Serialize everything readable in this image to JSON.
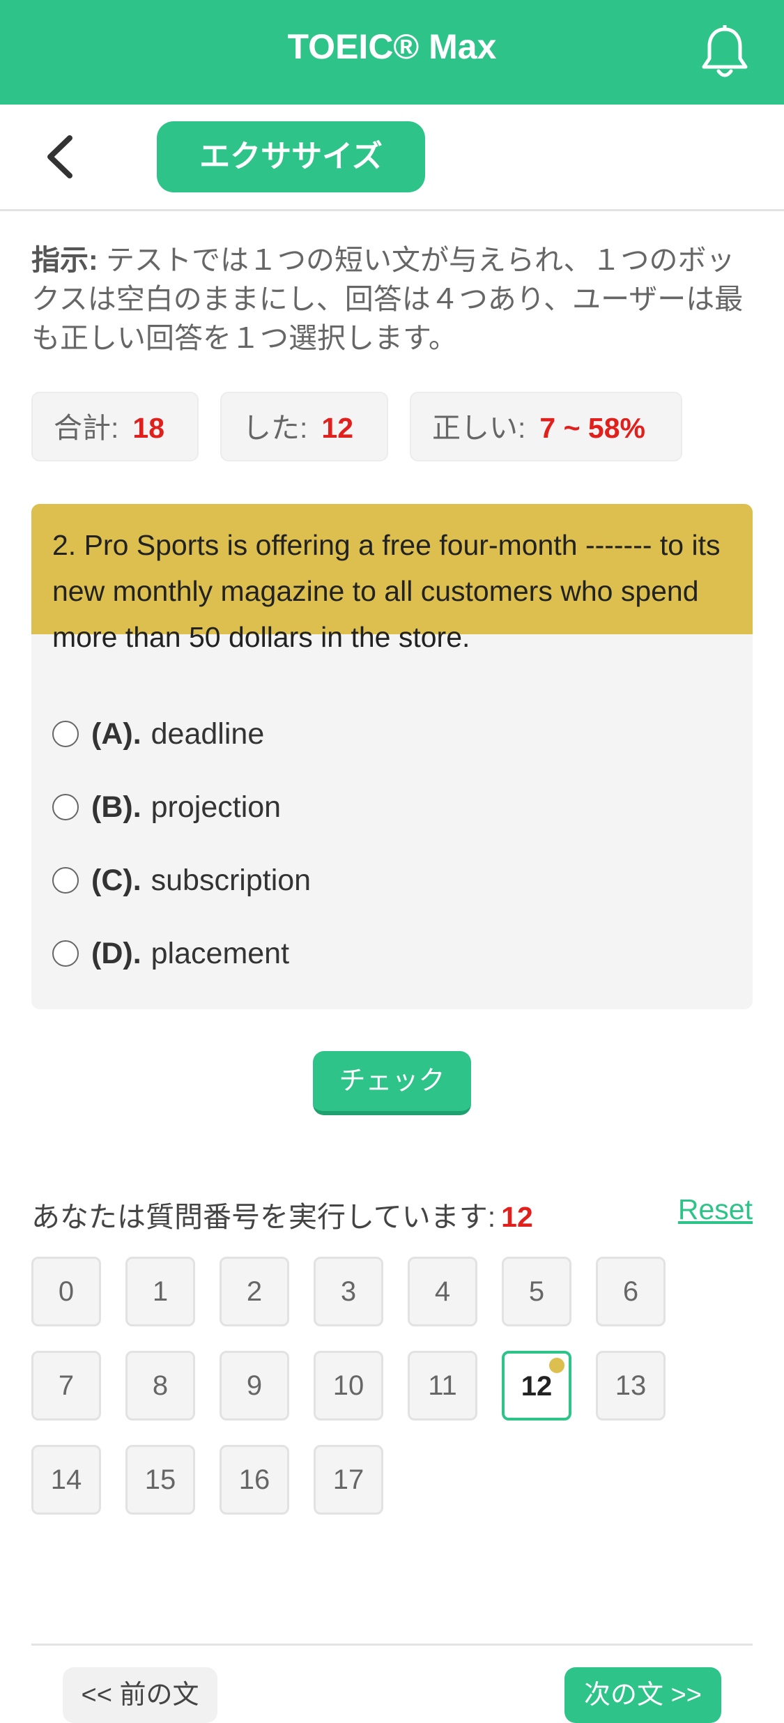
{
  "app": {
    "title": "TOEIC® Max"
  },
  "nav": {
    "tab_label": "エクササイズ"
  },
  "instructions": {
    "label": "指示:",
    "text": " テストでは１つの短い文が与えられ、１つのボックスは空白のままにし、回答は４つあり、ユーザーは最も正しい回答を１つ選択します。"
  },
  "stats": {
    "total_label": "合計:",
    "total_value": "18",
    "done_label": "した:",
    "done_value": "12",
    "correct_label": "正しい:",
    "correct_value": "7 ~ 58%"
  },
  "question": {
    "text": "2. Pro Sports is offering a free four-month ------- to its new monthly magazine to all customers who spend more than 50 dollars in the store.",
    "options": [
      {
        "key": "(A).",
        "text": "deadline"
      },
      {
        "key": "(B).",
        "text": "projection"
      },
      {
        "key": "(C).",
        "text": "subscription"
      },
      {
        "key": "(D).",
        "text": "placement"
      }
    ]
  },
  "check_label": "チェック",
  "progress": {
    "label": "あなたは質問番号を実行しています:",
    "current": "12",
    "reset_label": "Reset",
    "numbers": [
      "0",
      "1",
      "2",
      "3",
      "4",
      "5",
      "6",
      "7",
      "8",
      "9",
      "10",
      "11",
      "12",
      "13",
      "14",
      "15",
      "16",
      "17"
    ]
  },
  "footer": {
    "prev_label": "<< 前の文",
    "next_label": "次の文 >>"
  },
  "colors": {
    "accent": "#2ec489",
    "question_header": "#dcbf4e",
    "highlight": "#e0201c"
  }
}
